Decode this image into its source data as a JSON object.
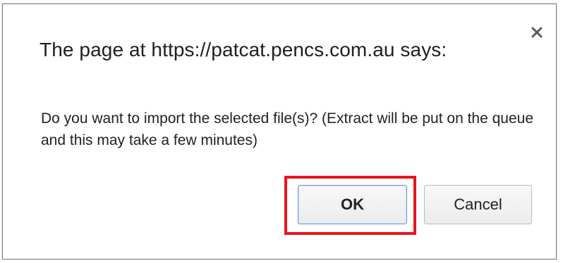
{
  "dialog": {
    "title": "The page at https://patcat.pencs.com.au says:",
    "message": "Do you want to import the selected file(s)? (Extract will be put on the queue and this may take a few minutes)",
    "close_icon": "close-icon",
    "buttons": {
      "ok_label": "OK",
      "cancel_label": "Cancel"
    },
    "colors": {
      "highlight": "#e8141c",
      "ok_border": "#6d9ad8"
    }
  }
}
